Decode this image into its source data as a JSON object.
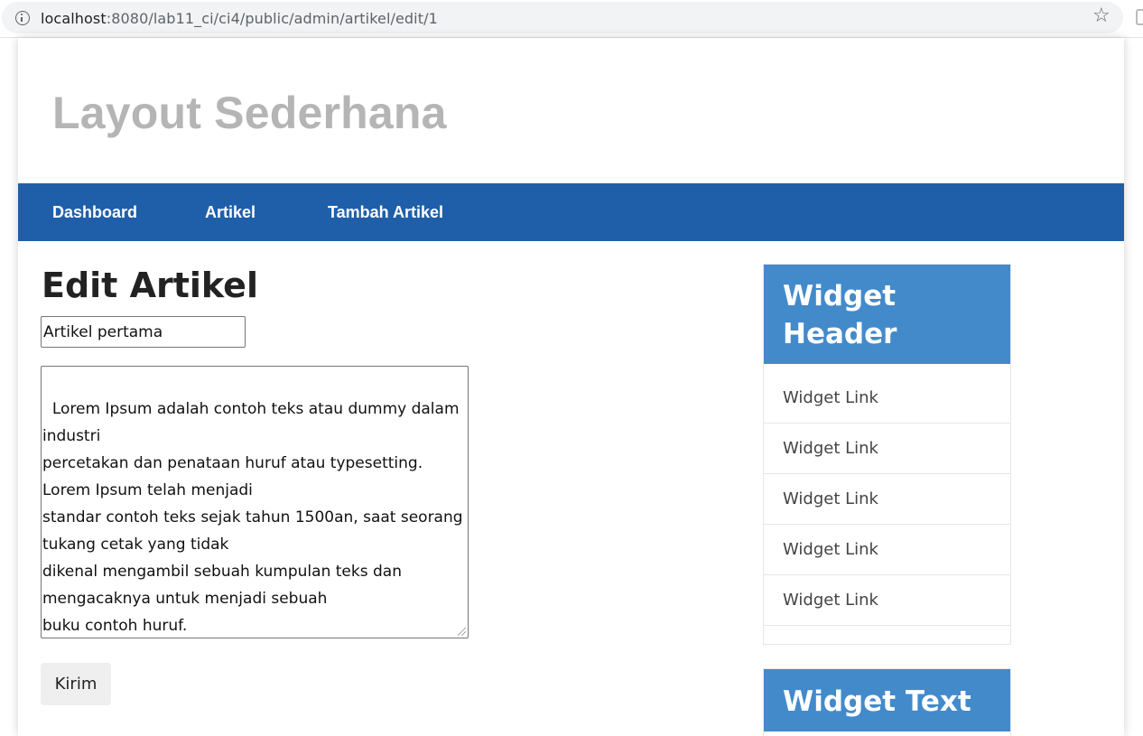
{
  "browser": {
    "url_host": "localhost",
    "url_path": ":8080/lab11_ci/ci4/public/admin/artikel/edit/1",
    "star_icon": "star-icon",
    "info_icon": "info-icon"
  },
  "header": {
    "title": "Layout Sederhana"
  },
  "nav": {
    "items": [
      {
        "label": "Dashboard"
      },
      {
        "label": "Artikel"
      },
      {
        "label": "Tambah Artikel"
      }
    ]
  },
  "main": {
    "heading": "Edit Artikel",
    "title_value": "Artikel pertama",
    "content_value": "Lorem Ipsum adalah contoh teks atau dummy dalam industri\npercetakan dan penataan huruf atau typesetting. Lorem Ipsum telah menjadi\nstandar contoh teks sejak tahun 1500an, saat seorang tukang cetak yang tidak\ndikenal mengambil sebuah kumpulan teks dan mengacaknya untuk menjadi sebuah\nbuku contoh huruf.",
    "submit_label": "Kirim"
  },
  "sidebar": {
    "widget_header": {
      "title": "Widget Header",
      "links": [
        {
          "label": "Widget Link"
        },
        {
          "label": "Widget Link"
        },
        {
          "label": "Widget Link"
        },
        {
          "label": "Widget Link"
        },
        {
          "label": "Widget Link"
        }
      ]
    },
    "widget_text": {
      "title": "Widget Text"
    }
  },
  "colors": {
    "nav_background": "#1f5faa",
    "widget_header_background": "#438acb",
    "site_title": "#b5b5b5"
  }
}
